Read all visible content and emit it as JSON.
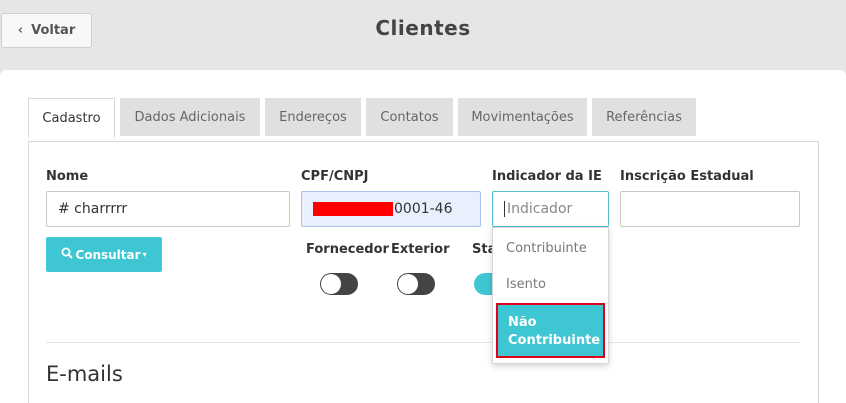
{
  "header": {
    "back_label": "Voltar",
    "title": "Clientes"
  },
  "tabs": [
    {
      "label": "Cadastro",
      "active": true
    },
    {
      "label": "Dados Adicionais",
      "active": false
    },
    {
      "label": "Endereços",
      "active": false
    },
    {
      "label": "Contatos",
      "active": false
    },
    {
      "label": "Movimentações",
      "active": false
    },
    {
      "label": "Referências",
      "active": false
    }
  ],
  "form": {
    "nome": {
      "label": "Nome",
      "value": "# charrrrr"
    },
    "cpf": {
      "label": "CPF/CNPJ",
      "value": "0001-46"
    },
    "indicador": {
      "label": "Indicador da IE",
      "placeholder": "Indicador"
    },
    "inscricao": {
      "label": "Inscrição Estadual",
      "value": ""
    },
    "consultar": "Consultar",
    "fornecedor": {
      "label": "Fornecedor",
      "on": false
    },
    "exterior": {
      "label": "Exterior",
      "on": false
    },
    "status": {
      "label": "Sta",
      "on": true
    }
  },
  "dropdown": {
    "options": [
      "Contribuinte",
      "Isento",
      "Não Contribuinte"
    ],
    "selected": "Não Contribuinte",
    "highlight_color": "#3ec7d3"
  },
  "emails": {
    "title": "E-mails"
  }
}
